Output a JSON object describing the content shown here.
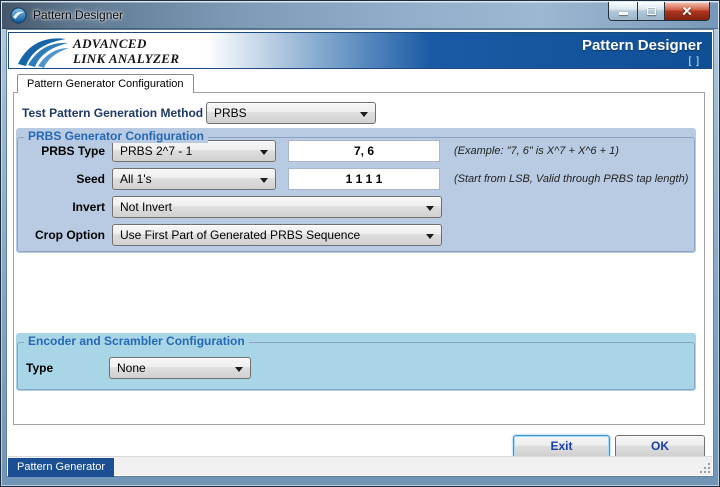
{
  "titlebar": {
    "title": "Pattern Designer"
  },
  "banner": {
    "brand_line1": "ADVANCED",
    "brand_line2": "LINK ANALYZER",
    "title": "Pattern Designer",
    "subtitle": "[ ]"
  },
  "tabs": {
    "pattern_generator_configuration": "Pattern Generator Configuration"
  },
  "method": {
    "label": "Test Pattern Generation Method",
    "value": "PRBS"
  },
  "prbs": {
    "title": "PRBS Generator Configuration",
    "type_row": {
      "label": "PRBS Type",
      "value": "PRBS 2^7 - 1",
      "field": "7, 6",
      "hint": "(Example: \"7, 6\" is X^7 + X^6 + 1)"
    },
    "seed_row": {
      "label": "Seed",
      "value": "All 1's",
      "field": "1 1 1 1",
      "hint": "(Start from LSB, Valid through PRBS tap length)"
    },
    "invert_row": {
      "label": "Invert",
      "value": "Not Invert"
    },
    "crop_row": {
      "label": "Crop Option",
      "value": "Use First Part of Generated PRBS Sequence"
    }
  },
  "encoder": {
    "title": "Encoder and Scrambler Configuration",
    "type_row": {
      "label": "Type",
      "value": "None"
    }
  },
  "footer": {
    "exit": "Exit",
    "ok": "OK"
  },
  "statusbar": {
    "text": "Pattern Generator"
  },
  "colors": {
    "banner_blue": "#0e4f96",
    "group_title_blue": "#2568b4",
    "method_label_navy": "#1e3a66",
    "prbs_group_bg": "#b9cbe2",
    "encoder_group_bg": "#a9d6e6",
    "button_text_blue": "#1b3ea6",
    "status_badge_bg": "#1a4f94"
  }
}
